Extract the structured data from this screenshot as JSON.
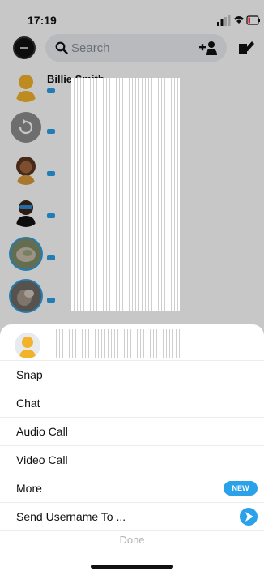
{
  "status": {
    "time": "17:19"
  },
  "header": {
    "search_placeholder": "Search"
  },
  "chats": [
    {
      "name": "Billie Smith"
    }
  ],
  "sheet": {
    "items": [
      {
        "label": "Snap"
      },
      {
        "label": "Chat"
      },
      {
        "label": "Audio Call"
      },
      {
        "label": "Video Call"
      },
      {
        "label": "More",
        "badge": "NEW"
      },
      {
        "label": "Send Username To ..."
      }
    ],
    "done_label": "Done"
  },
  "colors": {
    "accent": "#2aa1e8"
  }
}
